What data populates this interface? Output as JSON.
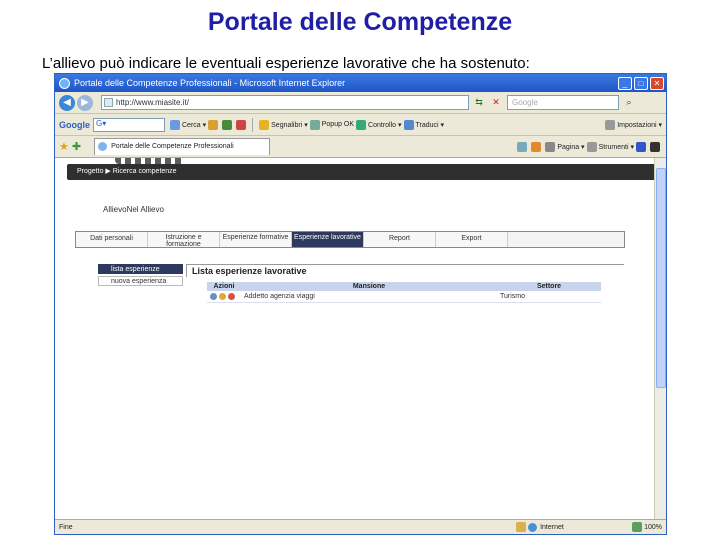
{
  "slide": {
    "title": "Portale delle Competenze",
    "subtitle": "L’allievo può indicare le eventuali esperienze lavorative che ha sostenuto:"
  },
  "browser": {
    "window_title": "Portale delle Competenze Professionali - Microsoft Internet Explorer",
    "address": "http://www.miasite.it/",
    "search_placeholder": "Google",
    "toolbar": {
      "google": "Google",
      "google_box": "G▾",
      "cerca": "Cerca ▾",
      "segnalibri": "Segnalibri ▾",
      "popup": "Popup OK",
      "controllo": "Controllo ▾",
      "traduci": "Traduci ▾",
      "impostazioni": "Impostazioni ▾"
    },
    "tab_label": "Portale delle Competenze Professionali",
    "tab_tools": {
      "pagina": "Pagina ▾",
      "strumenti": "Strumenti ▾"
    },
    "status": {
      "text": "Fine",
      "zone": "Internet",
      "zoom": "100%"
    }
  },
  "portal": {
    "nav": {
      "progetto": "Progetto",
      "arrow": "▶",
      "ricerca": "Ricerca competenze"
    },
    "user_name": "AllievoNel Allievo",
    "tabs": [
      {
        "label": "Dati personali"
      },
      {
        "label": "Istruzione e formazione"
      },
      {
        "label": "Esperienze formative"
      },
      {
        "label": "Esperienze lavorative"
      },
      {
        "label": "Report"
      },
      {
        "label": "Export"
      }
    ],
    "side_menu": {
      "lista": "lista esperienze",
      "nuova": "nuova esperienza"
    },
    "section_title": "Lista esperienze lavorative",
    "table": {
      "headers": [
        "Azioni",
        "Mansione",
        "Settore"
      ],
      "rows": [
        {
          "mansione": "Addetto agenzia viaggi",
          "settore": "Turismo"
        }
      ]
    }
  }
}
